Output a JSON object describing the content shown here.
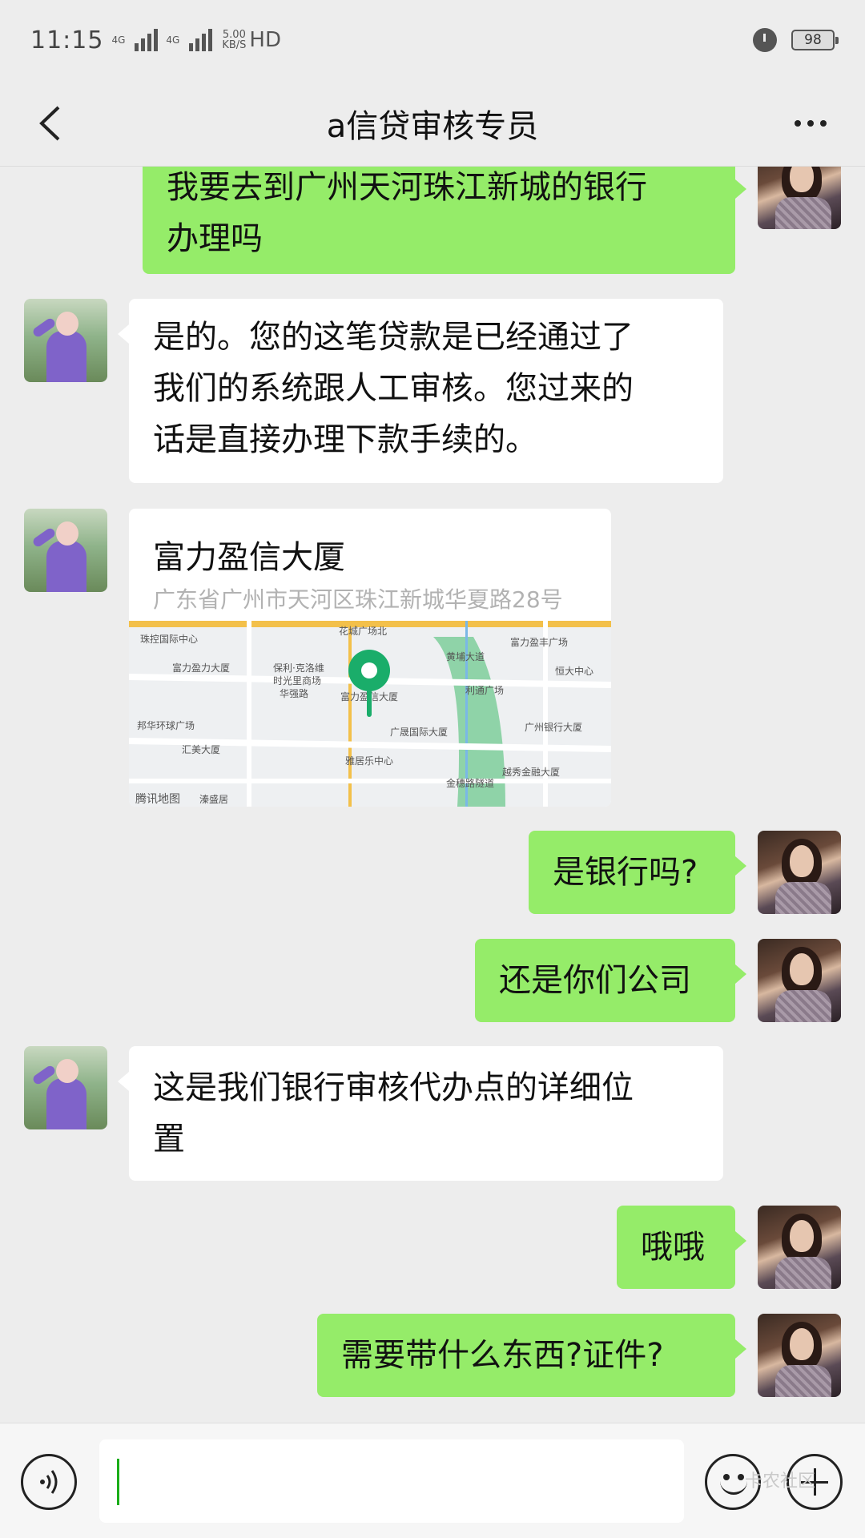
{
  "status_bar": {
    "time": "11:15",
    "network1": "4G",
    "network2": "4G",
    "speed_value": "5.00",
    "speed_unit": "KB/S",
    "hd": "HD",
    "battery": "98"
  },
  "header": {
    "title": "a信贷审核专员"
  },
  "messages": [
    {
      "side": "right",
      "text_line1": "我要去到广州天河珠江新城的银行",
      "text_line2": "办理吗"
    },
    {
      "side": "left",
      "text_line1": "是的。您的这笔贷款是已经通过了",
      "text_line2": "我们的系统跟人工审核。您过来的",
      "text_line3": "话是直接办理下款手续的。"
    },
    {
      "side": "left",
      "type": "location",
      "name": "富力盈信大厦",
      "address": "广东省广州市天河区珠江新城华夏路28号"
    },
    {
      "side": "right",
      "text": "是银行吗?"
    },
    {
      "side": "right",
      "text": "还是你们公司"
    },
    {
      "side": "left",
      "text_line1": "这是我们银行审核代办点的详细位",
      "text_line2": "置"
    },
    {
      "side": "right",
      "text": "哦哦"
    },
    {
      "side": "right",
      "text": "需要带什么东西?证件?"
    }
  ],
  "map": {
    "labels": [
      "珠控国际中心",
      "富力盈力大厦",
      "保利·克洛维",
      "时光里商场",
      "华强路",
      "花城广场北",
      "黄埔大道",
      "富力盈丰广场",
      "恒大中心",
      "利通广场",
      "富力盈信大厦",
      "广晟国际大厦",
      "广州银行大厦",
      "邦华环球广场",
      "汇美大厦",
      "雅居乐中心",
      "越秀金融大厦",
      "金穗路隧道",
      "腾讯地图",
      "溱盛居"
    ],
    "pin_color": "#1aad6a"
  },
  "input_bar": {
    "value": "",
    "watermark": "卡农社区"
  },
  "colors": {
    "self_bubble": "#95ec69",
    "other_bubble": "#ffffff",
    "background": "#ededed"
  }
}
